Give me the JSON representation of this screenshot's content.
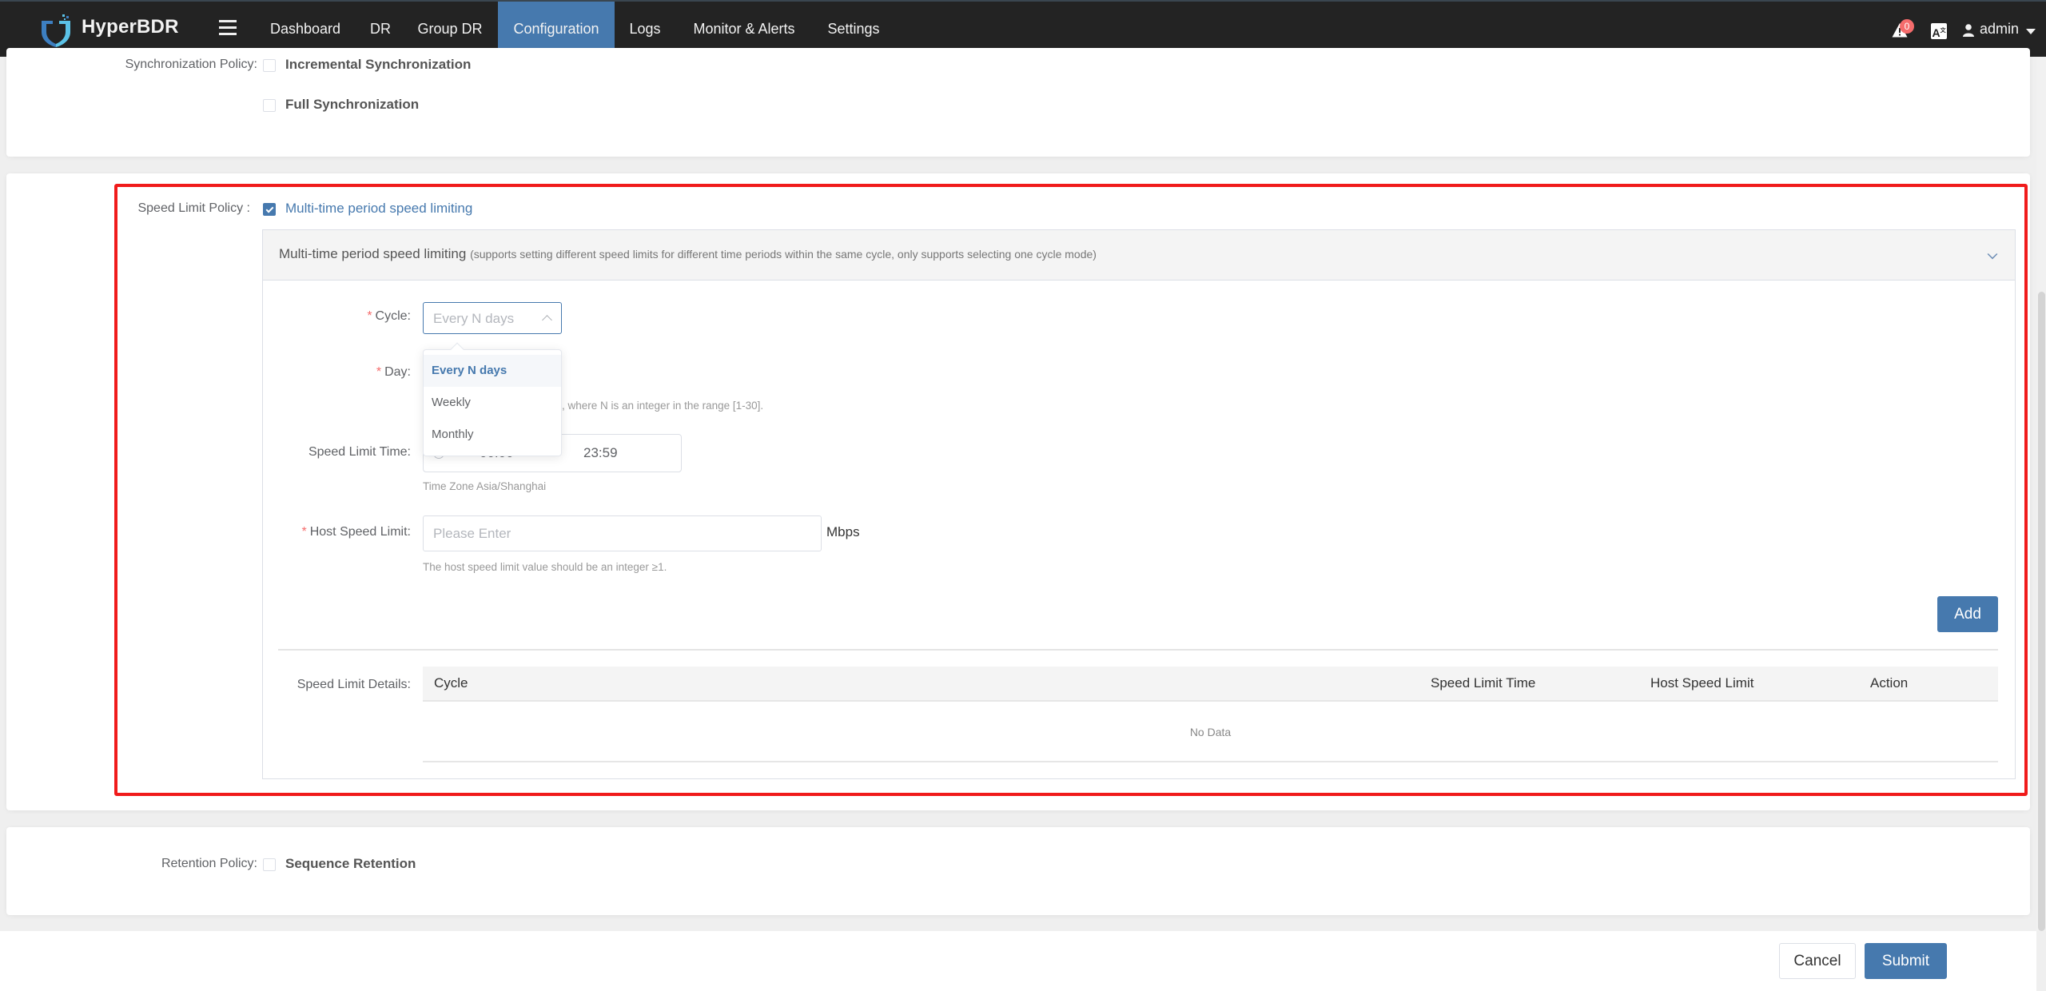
{
  "header": {
    "brand": "HyperBDR",
    "nav": [
      {
        "label": "Dashboard",
        "active": false
      },
      {
        "label": "DR",
        "active": false
      },
      {
        "label": "Group DR",
        "active": false
      },
      {
        "label": "Configuration",
        "active": true
      },
      {
        "label": "Logs",
        "active": false
      },
      {
        "label": "Monitor & Alerts",
        "active": false
      },
      {
        "label": "Settings",
        "active": false
      }
    ],
    "alert_count": "0",
    "language_icon": "A文",
    "user": "admin"
  },
  "sync_policy": {
    "label": "Synchronization Policy:",
    "options": [
      {
        "label": "Incremental Synchronization",
        "checked": false
      },
      {
        "label": "Full Synchronization",
        "checked": false
      }
    ]
  },
  "speed_limit": {
    "label": "Speed Limit Policy :",
    "option": {
      "label": "Multi-time period speed limiting",
      "checked": true
    },
    "panel": {
      "title": "Multi-time period speed limiting",
      "subtitle": "(supports setting different speed limits for different time periods within the same cycle, only supports selecting one cycle mode)"
    },
    "cycle": {
      "label": "Cycle:",
      "placeholder": "Every N days",
      "options": [
        "Every N days",
        "Weekly",
        "Monthly"
      ],
      "highlighted": "Every N days"
    },
    "day": {
      "label": "Day:",
      "hint": ", where N is an integer in the range [1-30]."
    },
    "time": {
      "label": "Speed Limit Time:",
      "start": "00:00",
      "end": "23:59",
      "timezone_hint": "Time Zone Asia/Shanghai"
    },
    "host_limit": {
      "label": "Host Speed Limit:",
      "placeholder": "Please Enter",
      "value": "",
      "unit": "Mbps",
      "hint": "The host speed limit value should be an integer ≥1."
    },
    "add_label": "Add",
    "details": {
      "label": "Speed Limit Details:",
      "columns": [
        "Cycle",
        "Speed Limit Time",
        "Host Speed Limit",
        "Action"
      ],
      "rows": [],
      "empty_text": "No Data"
    }
  },
  "retention_policy": {
    "label": "Retention Policy:",
    "option": {
      "label": "Sequence Retention",
      "checked": false
    }
  },
  "footer": {
    "cancel_label": "Cancel",
    "submit_label": "Submit"
  },
  "colors": {
    "header_bg": "#232323",
    "accent": "#4679ae",
    "highlight_box": "#f01b1b",
    "required": "#f56c6c"
  }
}
